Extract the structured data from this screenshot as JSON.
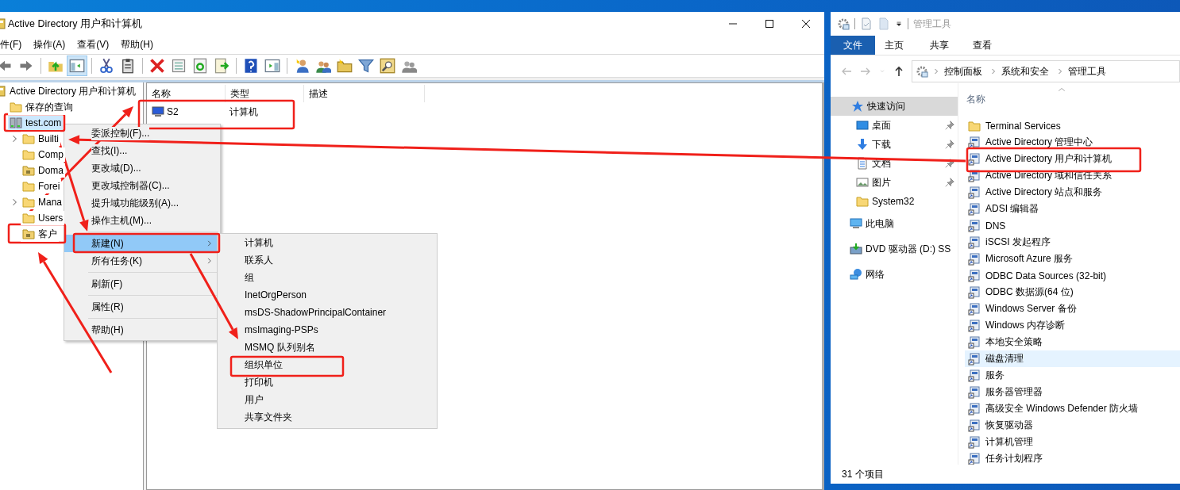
{
  "left_window": {
    "title": "Active Directory 用户和计算机",
    "menu": [
      "件(F)",
      "操作(A)",
      "查看(V)",
      "帮助(H)"
    ],
    "tree": [
      {
        "label": "Active Directory 用户和计算机",
        "kind": "root",
        "selected": false,
        "children": [
          {
            "label": "保存的查询",
            "kind": "folder",
            "expandable": false,
            "selected": false
          },
          {
            "label": "test.com",
            "kind": "domain",
            "expandable": false,
            "selected": true,
            "children": [
              {
                "label": "Builti",
                "kind": "folder",
                "expandable": true,
                "selected": false
              },
              {
                "label": "Comp",
                "kind": "folder",
                "expandable": false,
                "selected": false
              },
              {
                "label": "Doma",
                "kind": "ou",
                "expandable": false,
                "selected": false
              },
              {
                "label": "Forei",
                "kind": "folder",
                "expandable": false,
                "selected": false
              },
              {
                "label": "Mana",
                "kind": "folder",
                "expandable": true,
                "selected": false
              },
              {
                "label": "Users",
                "kind": "folder",
                "expandable": false,
                "selected": false
              },
              {
                "label": "客户",
                "kind": "ou",
                "expandable": false,
                "selected": false
              }
            ]
          }
        ]
      }
    ],
    "list": {
      "columns": [
        "名称",
        "类型",
        "描述"
      ],
      "rows": [
        {
          "name": "S2",
          "type": "计算机"
        }
      ]
    },
    "context_menu": [
      {
        "kind": "item",
        "label": "委派控制(F)...",
        "submenu": false,
        "selected": false
      },
      {
        "kind": "item",
        "label": "查找(I)...",
        "submenu": false,
        "selected": false
      },
      {
        "kind": "item",
        "label": "更改域(D)...",
        "submenu": false,
        "selected": false
      },
      {
        "kind": "item",
        "label": "更改域控制器(C)...",
        "submenu": false,
        "selected": false
      },
      {
        "kind": "item",
        "label": "提升域功能级别(A)...",
        "submenu": false,
        "selected": false
      },
      {
        "kind": "item",
        "label": "操作主机(M)...",
        "submenu": false,
        "selected": false
      },
      {
        "kind": "separator"
      },
      {
        "kind": "item",
        "label": "新建(N)",
        "submenu": true,
        "selected": true
      },
      {
        "kind": "item",
        "label": "所有任务(K)",
        "submenu": true,
        "selected": false
      },
      {
        "kind": "separator"
      },
      {
        "kind": "item",
        "label": "刷新(F)",
        "submenu": false,
        "selected": false
      },
      {
        "kind": "separator"
      },
      {
        "kind": "item",
        "label": "属性(R)",
        "submenu": false,
        "selected": false
      },
      {
        "kind": "separator"
      },
      {
        "kind": "item",
        "label": "帮助(H)",
        "submenu": false,
        "selected": false
      }
    ],
    "submenu": [
      "计算机",
      "联系人",
      "组",
      "InetOrgPerson",
      "msDS-ShadowPrincipalContainer",
      "msImaging-PSPs",
      "MSMQ 队列别名",
      "组织单位",
      "打印机",
      "用户",
      "共享文件夹"
    ]
  },
  "right_window": {
    "title": "管理工具",
    "ribbon_tabs": [
      {
        "label": "文件",
        "selected": true
      },
      {
        "label": "主页",
        "selected": false
      },
      {
        "label": "共享",
        "selected": false
      },
      {
        "label": "查看",
        "selected": false
      }
    ],
    "breadcrumb": [
      "控制面板",
      "系统和安全",
      "管理工具"
    ],
    "nav": [
      {
        "label": "快速访问",
        "kind": "quick",
        "pinned": false,
        "selected": true
      },
      {
        "label": "桌面",
        "kind": "desktop",
        "pinned": true,
        "selected": false
      },
      {
        "label": "下载",
        "kind": "download",
        "pinned": true,
        "selected": false
      },
      {
        "label": "文档",
        "kind": "document",
        "pinned": true,
        "selected": false
      },
      {
        "label": "图片",
        "kind": "pictures",
        "pinned": true,
        "selected": false
      },
      {
        "label": "System32",
        "kind": "folder",
        "pinned": false,
        "selected": false
      },
      {
        "label": "此电脑",
        "kind": "pc",
        "pinned": false,
        "selected": false
      },
      {
        "label": "DVD 驱动器 (D:) SS",
        "kind": "dvd",
        "pinned": false,
        "selected": false
      },
      {
        "label": "网络",
        "kind": "network",
        "pinned": false,
        "selected": false
      }
    ],
    "column": "名称",
    "files": [
      {
        "label": "Terminal Services",
        "kind": "folder",
        "hovered": false
      },
      {
        "label": "Active Directory 管理中心",
        "kind": "tool",
        "hovered": false
      },
      {
        "label": "Active Directory 用户和计算机",
        "kind": "tool",
        "hovered": false
      },
      {
        "label": "Active Directory 域和信任关系",
        "kind": "tool",
        "hovered": false
      },
      {
        "label": "Active Directory 站点和服务",
        "kind": "tool",
        "hovered": false
      },
      {
        "label": "ADSI 编辑器",
        "kind": "tool",
        "hovered": false
      },
      {
        "label": "DNS",
        "kind": "tool",
        "hovered": false
      },
      {
        "label": "iSCSI 发起程序",
        "kind": "tool",
        "hovered": false
      },
      {
        "label": "Microsoft Azure 服务",
        "kind": "tool",
        "hovered": false
      },
      {
        "label": "ODBC Data Sources (32-bit)",
        "kind": "tool",
        "hovered": false
      },
      {
        "label": "ODBC 数据源(64 位)",
        "kind": "tool",
        "hovered": false
      },
      {
        "label": "Windows Server 备份",
        "kind": "tool",
        "hovered": false
      },
      {
        "label": "Windows 内存诊断",
        "kind": "tool",
        "hovered": false
      },
      {
        "label": "本地安全策略",
        "kind": "tool",
        "hovered": false
      },
      {
        "label": "磁盘清理",
        "kind": "tool",
        "hovered": true
      },
      {
        "label": "服务",
        "kind": "tool",
        "hovered": false
      },
      {
        "label": "服务器管理器",
        "kind": "tool",
        "hovered": false
      },
      {
        "label": "高级安全 Windows Defender 防火墙",
        "kind": "tool",
        "hovered": false
      },
      {
        "label": "恢复驱动器",
        "kind": "tool",
        "hovered": false
      },
      {
        "label": "计算机管理",
        "kind": "tool",
        "hovered": false
      },
      {
        "label": "任务计划程序",
        "kind": "tool",
        "hovered": false
      }
    ],
    "status": "31 个项目"
  },
  "annotations": [
    {
      "kind": "box"
    },
    {
      "kind": "box"
    },
    {
      "kind": "box"
    },
    {
      "kind": "box"
    },
    {
      "kind": "box"
    },
    {
      "kind": "box"
    },
    {
      "kind": "arrow"
    },
    {
      "kind": "arrow"
    },
    {
      "kind": "arrow"
    },
    {
      "kind": "arrow"
    },
    {
      "kind": "arrow"
    }
  ]
}
